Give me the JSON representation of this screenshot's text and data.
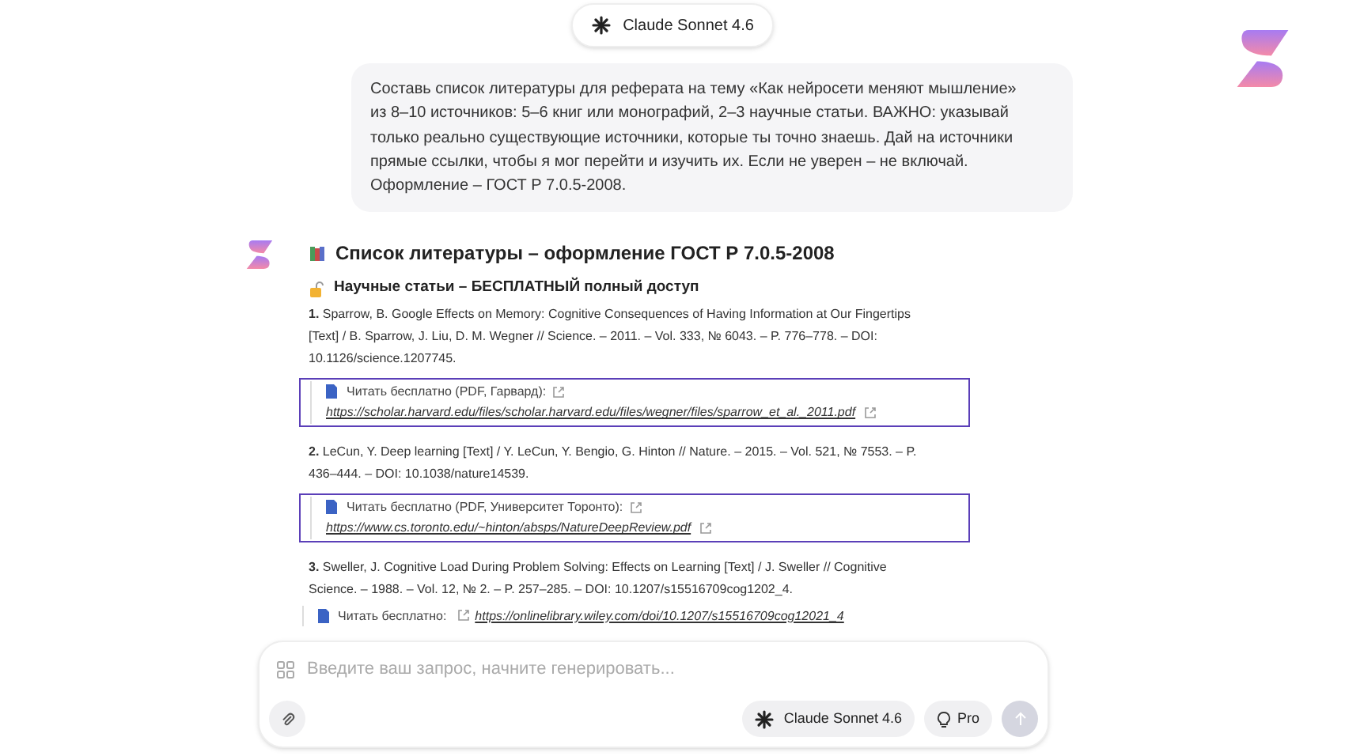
{
  "model_selector": {
    "label": "Claude Sonnet 4.6"
  },
  "user_message": "Составь список литературы для реферата на тему «Как нейросети меняют мышление» из 8–10 источников: 5–6 книг или монографий, 2–3 научные статьи. ВАЖНО: указывай только реально существующие источники, которые ты точно знаешь. Дай на источники прямые ссылки, чтобы я мог перейти и изучить их. Если не уверен – не включай. Оформление – ГОСТ Р 7.0.5-2008.",
  "response": {
    "title": "Список литературы – оформление ГОСТ Р 7.0.5-2008",
    "section": "Научные статьи – БЕСПЛАТНЫЙ полный доступ",
    "entries": [
      {
        "citation": "**1.** Sparrow, B. Google Effects on Memory: Cognitive Consequences of Having Information at Our Fingertips [Text] / B. Sparrow, J. Liu, D. M. Wegner // Science. – 2011. – Vol. 333, № 6043. – P. 776–778. – DOI: 10.1126/science.1207745.",
        "kind": "block",
        "highlighted": true,
        "link_label": "Читать бесплатно (PDF, Гарвард):",
        "url": "https://scholar.harvard.edu/files/scholar.harvard.edu/files/wegner/files/sparrow_et_al._2011.pdf"
      },
      {
        "citation": "**2.** LeCun, Y. Deep learning [Text] / Y. LeCun, Y. Bengio, G. Hinton // Nature. – 2015. – Vol. 521, № 7553. – P. 436–444. – DOI: 10.1038/nature14539.",
        "kind": "block",
        "highlighted": true,
        "link_label": "Читать бесплатно (PDF, Университет Торонто):",
        "url": "https://www.cs.toronto.edu/~hinton/absps/NatureDeepReview.pdf"
      },
      {
        "citation": "**3.** Sweller, J. Cognitive Load During Problem Solving: Effects on Learning [Text] / J. Sweller // Cognitive Science. – 1988. – Vol. 12, № 2. – P. 257–285. – DOI: 10.1207/s15516709cog1202_4.",
        "kind": "inline",
        "highlighted": false,
        "link_label": "Читать бесплатно:",
        "url": "https://onlinelibrary.wiley.com/doi/10.1207/s15516709cog12021_4"
      }
    ]
  },
  "composer": {
    "placeholder": "Введите ваш запрос, начните генерировать...",
    "model": "Claude Sonnet 4.6",
    "mode": "Pro"
  }
}
